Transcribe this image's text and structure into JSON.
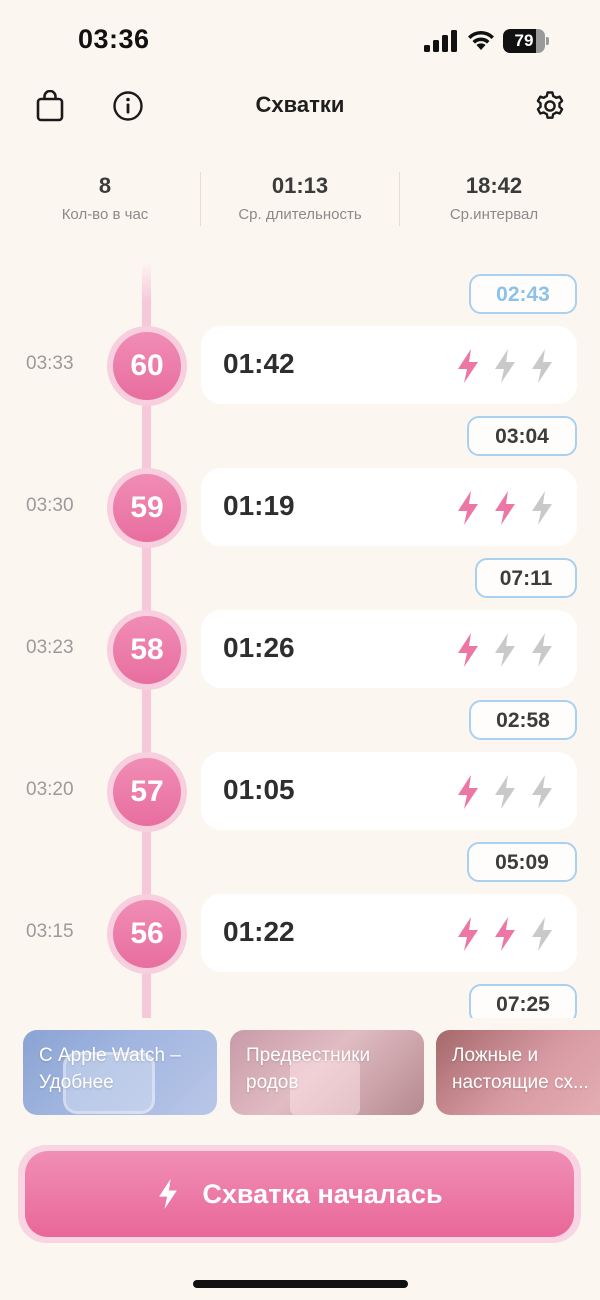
{
  "status_bar": {
    "time": "03:36",
    "battery": "79",
    "battery_level": 0.79
  },
  "header": {
    "title": "Схватки",
    "icons": [
      "bag-icon",
      "info-icon",
      "gear-icon"
    ]
  },
  "stats": [
    {
      "value": "8",
      "label": "Кол-во в час"
    },
    {
      "value": "01:13",
      "label": "Ср. длительность"
    },
    {
      "value": "18:42",
      "label": "Ср.интервал"
    }
  ],
  "timeline": {
    "running_interval": "02:43",
    "contractions": [
      {
        "number": "60",
        "time": "03:33",
        "duration": "01:42",
        "intensity": 1,
        "interval_after": "03:04"
      },
      {
        "number": "59",
        "time": "03:30",
        "duration": "01:19",
        "intensity": 2,
        "interval_after": "07:11"
      },
      {
        "number": "58",
        "time": "03:23",
        "duration": "01:26",
        "intensity": 1,
        "interval_after": "02:58"
      },
      {
        "number": "57",
        "time": "03:20",
        "duration": "01:05",
        "intensity": 1,
        "interval_after": "05:09"
      },
      {
        "number": "56",
        "time": "03:15",
        "duration": "01:22",
        "intensity": 2,
        "interval_after": "07:25"
      }
    ]
  },
  "tips": [
    {
      "title": "С Apple Watch – Удобнее"
    },
    {
      "title": "Предвестники родов"
    },
    {
      "title": "Ложные и настоящие сх..."
    }
  ],
  "main_button": {
    "label": "Схватка началась",
    "icon": "bolt-icon"
  },
  "colors": {
    "accent": "#ec77a4",
    "accent_light": "#f8cfde",
    "interval_border": "#a9d0ef",
    "bolt_inactive": "#c9c9c9",
    "background": "#fcf6f1"
  }
}
